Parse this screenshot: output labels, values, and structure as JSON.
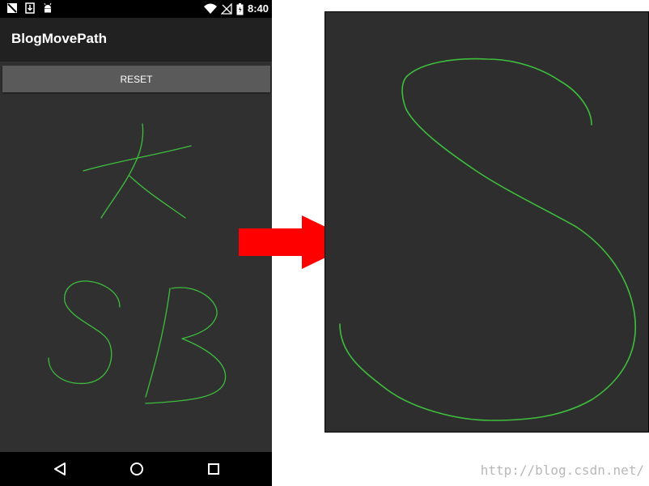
{
  "status_bar": {
    "time": "8:40",
    "icons": [
      "no-sim-icon",
      "download-icon",
      "android-icon",
      "wifi-icon",
      "signal-icon",
      "battery-icon"
    ]
  },
  "app": {
    "title": "BlogMovePath",
    "reset_label": "RESET"
  },
  "nav_bar": {
    "icons": [
      "back-icon",
      "home-icon",
      "recents-icon"
    ]
  },
  "colors": {
    "stroke": "#3dbe3d",
    "canvas_bg": "#303030",
    "arrow": "#ff0000"
  },
  "watermark": "http://blog.csdn.net/"
}
